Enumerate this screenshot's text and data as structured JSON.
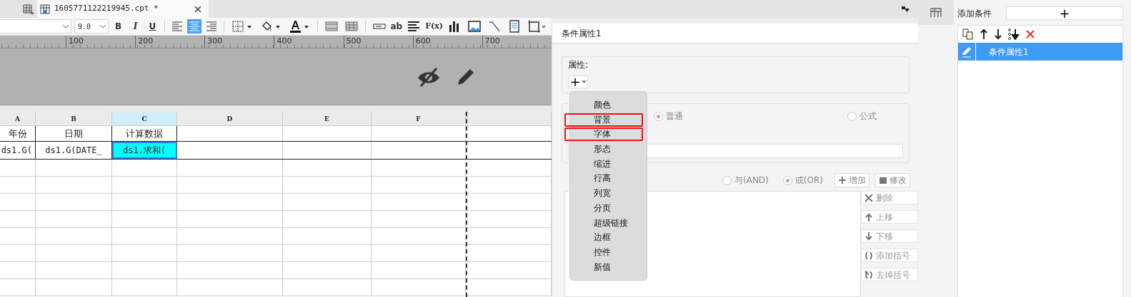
{
  "tabs": [
    {
      "label": "1605771122219945.cpt *",
      "selected": true
    }
  ],
  "toolbar": {
    "font_size": "9.0",
    "styles": [
      "B",
      "I",
      "U"
    ],
    "align": [
      {
        "kind": "left",
        "selected": false
      },
      {
        "kind": "center",
        "selected": true
      },
      {
        "kind": "right",
        "selected": false
      }
    ],
    "text_tools": [
      "ab",
      "F(x)"
    ]
  },
  "ruler": {
    "ticks": [
      "100",
      "200",
      "300",
      "400",
      "500",
      "600",
      "700"
    ]
  },
  "sheet": {
    "columns": [
      {
        "label": "A",
        "selected": false
      },
      {
        "label": "B",
        "selected": false
      },
      {
        "label": "C",
        "selected": true
      },
      {
        "label": "D",
        "selected": false
      },
      {
        "label": "E",
        "selected": false
      },
      {
        "label": "F",
        "selected": false
      }
    ],
    "rows": [
      [
        {
          "text": "年份",
          "selected": false
        },
        {
          "text": "日期",
          "selected": false
        },
        {
          "text": "计算数据",
          "selected": false
        }
      ],
      [
        {
          "text": "ds1.G(",
          "selected": false
        },
        {
          "text": "ds1.G(DATE_",
          "selected": false
        },
        {
          "text": "ds1.求和(",
          "selected": true
        }
      ]
    ]
  },
  "dialog": {
    "title": "条件属性1",
    "property_label": "属性:",
    "add_symbol": "+",
    "menu": [
      {
        "label": "颜色",
        "highlighted": false
      },
      {
        "label": "背景",
        "highlighted": true
      },
      {
        "label": "字体",
        "highlighted": true
      },
      {
        "label": "形态",
        "highlighted": false
      },
      {
        "label": "缩进",
        "highlighted": false
      },
      {
        "label": "行高",
        "highlighted": false
      },
      {
        "label": "列宽",
        "highlighted": false
      },
      {
        "label": "分页",
        "highlighted": false
      },
      {
        "label": "超级链接",
        "highlighted": false
      },
      {
        "label": "边框",
        "highlighted": false
      },
      {
        "label": "控件",
        "highlighted": false
      },
      {
        "label": "新值",
        "highlighted": false
      }
    ],
    "type_options": [
      {
        "label": "普通",
        "selected": true
      },
      {
        "label": "公式",
        "selected": false
      }
    ],
    "logic_options": [
      {
        "label": "与(AND)",
        "selected": false
      },
      {
        "label": "或(OR)",
        "selected": true
      }
    ],
    "buttons": [
      {
        "kind": "add",
        "label": "增加"
      },
      {
        "kind": "edit",
        "label": "修改"
      }
    ],
    "side_buttons": [
      {
        "kind": "delete",
        "label": "删除"
      },
      {
        "kind": "up",
        "label": "上移"
      },
      {
        "kind": "down",
        "label": "下移"
      },
      {
        "kind": "paren",
        "label": "添加括号"
      },
      {
        "kind": "unparen",
        "label": "去掉括号"
      }
    ]
  },
  "conditions": {
    "title": "添加条件",
    "add_symbol": "+",
    "items": [
      {
        "label": "条件属性1",
        "selected": true
      }
    ]
  }
}
